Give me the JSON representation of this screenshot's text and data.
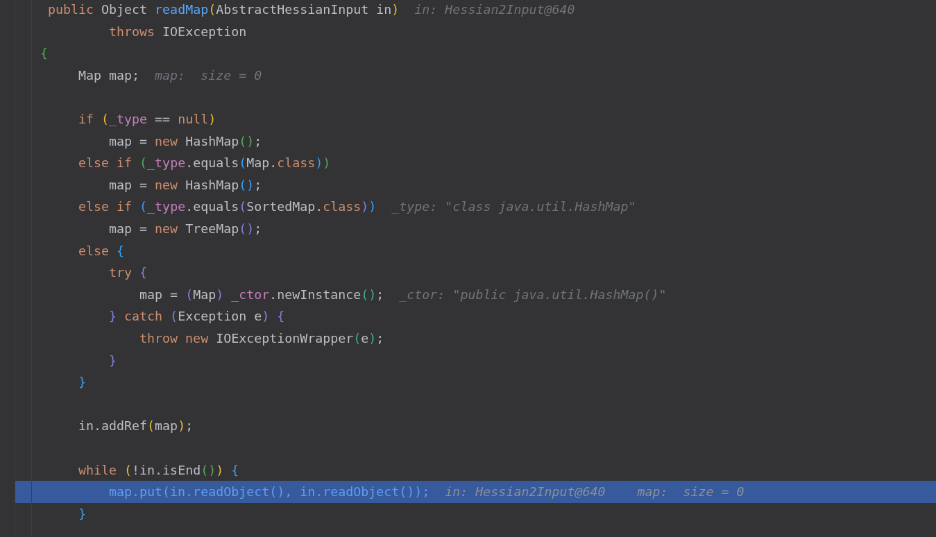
{
  "editor": {
    "lines": [
      {
        "current": false,
        "tokens": [
          {
            "kind": "keyword",
            "text": " public "
          },
          {
            "kind": "plain",
            "text": "Object "
          },
          {
            "kind": "declaration",
            "text": "readMap"
          },
          {
            "kind": "bracket",
            "color": "#e8ba36",
            "text": "("
          },
          {
            "kind": "plain",
            "text": "AbstractHessianInput in"
          },
          {
            "kind": "bracket",
            "color": "#e8ba36",
            "text": ")"
          }
        ],
        "hints": [
          "in: Hessian2Input@640"
        ]
      },
      {
        "current": false,
        "tokens": [
          {
            "kind": "keyword",
            "text": "         throws "
          },
          {
            "kind": "plain",
            "text": "IOException"
          }
        ]
      },
      {
        "current": false,
        "tokens": [
          {
            "kind": "bracket",
            "color": "#54a857",
            "text": "{"
          }
        ]
      },
      {
        "current": false,
        "tokens": [
          {
            "kind": "plain",
            "text": "     Map map;"
          }
        ],
        "hints": [
          "map:  size = 0"
        ]
      },
      {
        "current": false
      },
      {
        "current": false,
        "tokens": [
          {
            "kind": "keyword",
            "text": "     if "
          },
          {
            "kind": "bracket",
            "color": "#e8ba36",
            "text": "("
          },
          {
            "kind": "field",
            "text": "_type"
          },
          {
            "kind": "plain",
            "text": " == "
          },
          {
            "kind": "keyword",
            "text": "null"
          },
          {
            "kind": "bracket",
            "color": "#e8ba36",
            "text": ")"
          }
        ]
      },
      {
        "current": false,
        "tokens": [
          {
            "kind": "plain",
            "text": "         map = "
          },
          {
            "kind": "keyword",
            "text": "new "
          },
          {
            "kind": "plain",
            "text": "HashMap"
          },
          {
            "kind": "bracket",
            "color": "#54a857",
            "text": "()"
          },
          {
            "kind": "plain",
            "text": ";"
          }
        ]
      },
      {
        "current": false,
        "tokens": [
          {
            "kind": "keyword",
            "text": "     else if "
          },
          {
            "kind": "bracket",
            "color": "#54a857",
            "text": "("
          },
          {
            "kind": "field",
            "text": "_type"
          },
          {
            "kind": "plain",
            "text": ".equals"
          },
          {
            "kind": "bracket",
            "color": "#359ff4",
            "text": "("
          },
          {
            "kind": "plain",
            "text": "Map."
          },
          {
            "kind": "keyword",
            "text": "class"
          },
          {
            "kind": "bracket",
            "color": "#359ff4",
            "text": ")"
          },
          {
            "kind": "bracket",
            "color": "#54a857",
            "text": ")"
          }
        ]
      },
      {
        "current": false,
        "tokens": [
          {
            "kind": "plain",
            "text": "         map = "
          },
          {
            "kind": "keyword",
            "text": "new "
          },
          {
            "kind": "plain",
            "text": "HashMap"
          },
          {
            "kind": "bracket",
            "color": "#359ff4",
            "text": "()"
          },
          {
            "kind": "plain",
            "text": ";"
          }
        ]
      },
      {
        "current": false,
        "tokens": [
          {
            "kind": "keyword",
            "text": "     else if "
          },
          {
            "kind": "bracket",
            "color": "#359ff4",
            "text": "("
          },
          {
            "kind": "field",
            "text": "_type"
          },
          {
            "kind": "plain",
            "text": ".equals"
          },
          {
            "kind": "bracket",
            "color": "#7f7fdf",
            "text": "("
          },
          {
            "kind": "plain",
            "text": "SortedMap."
          },
          {
            "kind": "keyword",
            "text": "class"
          },
          {
            "kind": "bracket",
            "color": "#7f7fdf",
            "text": ")"
          },
          {
            "kind": "bracket",
            "color": "#359ff4",
            "text": ")"
          }
        ],
        "hints": [
          "_type: \"class java.util.HashMap\""
        ]
      },
      {
        "current": false,
        "tokens": [
          {
            "kind": "plain",
            "text": "         map = "
          },
          {
            "kind": "keyword",
            "text": "new "
          },
          {
            "kind": "plain",
            "text": "TreeMap"
          },
          {
            "kind": "bracket",
            "color": "#7f7fdf",
            "text": "()"
          },
          {
            "kind": "plain",
            "text": ";"
          }
        ]
      },
      {
        "current": false,
        "tokens": [
          {
            "kind": "keyword",
            "text": "     else "
          },
          {
            "kind": "bracket",
            "color": "#359ff4",
            "text": "{"
          }
        ]
      },
      {
        "current": false,
        "tokens": [
          {
            "kind": "keyword",
            "text": "         try "
          },
          {
            "kind": "bracket",
            "color": "#7f7fdf",
            "text": "{"
          }
        ]
      },
      {
        "current": false,
        "tokens": [
          {
            "kind": "plain",
            "text": "             map = "
          },
          {
            "kind": "bracket",
            "color": "#7f7fdf",
            "text": "("
          },
          {
            "kind": "plain",
            "text": "Map"
          },
          {
            "kind": "bracket",
            "color": "#7f7fdf",
            "text": ")"
          },
          {
            "kind": "field",
            "text": " _ctor"
          },
          {
            "kind": "plain",
            "text": ".newInstance"
          },
          {
            "kind": "bracket",
            "color": "#3dab8e",
            "text": "()"
          },
          {
            "kind": "plain",
            "text": ";"
          }
        ],
        "hints": [
          "_ctor: \"public java.util.HashMap()\""
        ]
      },
      {
        "current": false,
        "tokens": [
          {
            "kind": "bracket",
            "color": "#7f7fdf",
            "text": "         }"
          },
          {
            "kind": "keyword",
            "text": " catch "
          },
          {
            "kind": "bracket",
            "color": "#7f7fdf",
            "text": "("
          },
          {
            "kind": "plain",
            "text": "Exception e"
          },
          {
            "kind": "bracket",
            "color": "#7f7fdf",
            "text": ") {"
          }
        ]
      },
      {
        "current": false,
        "tokens": [
          {
            "kind": "keyword",
            "text": "             throw new "
          },
          {
            "kind": "plain",
            "text": "IOExceptionWrapper"
          },
          {
            "kind": "bracket",
            "color": "#3dab8e",
            "text": "("
          },
          {
            "kind": "plain",
            "text": "e"
          },
          {
            "kind": "bracket",
            "color": "#3dab8e",
            "text": ")"
          },
          {
            "kind": "plain",
            "text": ";"
          }
        ]
      },
      {
        "current": false,
        "tokens": [
          {
            "kind": "bracket",
            "color": "#7f7fdf",
            "text": "         }"
          }
        ]
      },
      {
        "current": false,
        "tokens": [
          {
            "kind": "bracket",
            "color": "#359ff4",
            "text": "     }"
          }
        ]
      },
      {
        "current": false
      },
      {
        "current": false,
        "tokens": [
          {
            "kind": "plain",
            "text": "     in.addRef"
          },
          {
            "kind": "bracket",
            "color": "#e8ba36",
            "text": "("
          },
          {
            "kind": "plain",
            "text": "map"
          },
          {
            "kind": "bracket",
            "color": "#e8ba36",
            "text": ")"
          },
          {
            "kind": "plain",
            "text": ";"
          }
        ]
      },
      {
        "current": false
      },
      {
        "current": false,
        "tokens": [
          {
            "kind": "keyword",
            "text": "     while "
          },
          {
            "kind": "bracket",
            "color": "#e8ba36",
            "text": "("
          },
          {
            "kind": "plain",
            "text": "!in.isEnd"
          },
          {
            "kind": "bracket",
            "color": "#54a857",
            "text": "()"
          },
          {
            "kind": "bracket",
            "color": "#e8ba36",
            "text": ")"
          },
          {
            "kind": "bracket",
            "color": "#359ff4",
            "text": " {"
          }
        ]
      },
      {
        "current": true,
        "tokens": [
          {
            "kind": "plain",
            "text": "         map.put(in.readObject(), in.readObject());"
          }
        ],
        "hints": [
          "in: Hessian2Input@640",
          "map:  size = 0"
        ]
      },
      {
        "current": false,
        "tokens": [
          {
            "kind": "bracket",
            "color": "#359ff4",
            "text": "     }"
          }
        ]
      }
    ]
  }
}
